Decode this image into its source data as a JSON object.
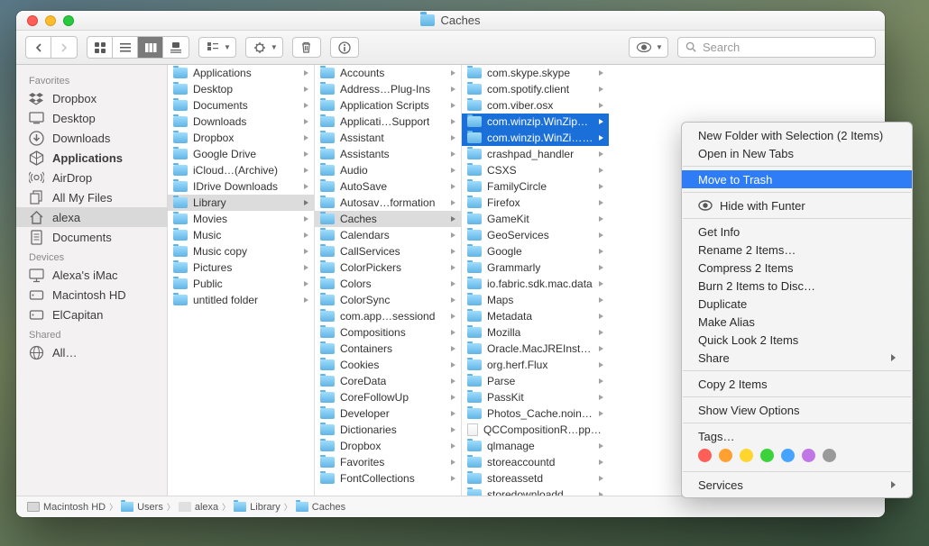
{
  "title": "Caches",
  "search_placeholder": "Search",
  "sidebar": {
    "sections": [
      {
        "header": "Favorites",
        "items": [
          {
            "icon": "dropbox",
            "label": "Dropbox"
          },
          {
            "icon": "desktop",
            "label": "Desktop"
          },
          {
            "icon": "downloads",
            "label": "Downloads"
          },
          {
            "icon": "apps",
            "label": "Applications",
            "bold": true
          },
          {
            "icon": "airdrop",
            "label": "AirDrop"
          },
          {
            "icon": "allfiles",
            "label": "All My Files"
          },
          {
            "icon": "home",
            "label": "alexa",
            "sel": true
          },
          {
            "icon": "docs",
            "label": "Documents"
          }
        ]
      },
      {
        "header": "Devices",
        "items": [
          {
            "icon": "imac",
            "label": "Alexa's iMac"
          },
          {
            "icon": "hd",
            "label": "Macintosh HD"
          },
          {
            "icon": "hd",
            "label": "ElCapitan"
          }
        ]
      },
      {
        "header": "Shared",
        "items": [
          {
            "icon": "globe",
            "label": "All…"
          }
        ]
      }
    ]
  },
  "columns": [
    [
      {
        "n": "Applications",
        "t": "folder"
      },
      {
        "n": "Desktop",
        "t": "folder"
      },
      {
        "n": "Documents",
        "t": "folder"
      },
      {
        "n": "Downloads",
        "t": "folder"
      },
      {
        "n": "Dropbox",
        "t": "folder"
      },
      {
        "n": "Google Drive",
        "t": "folder"
      },
      {
        "n": "iCloud…(Archive)",
        "t": "folder"
      },
      {
        "n": "IDrive Downloads",
        "t": "folder"
      },
      {
        "n": "Library",
        "t": "folder",
        "sel": true
      },
      {
        "n": "Movies",
        "t": "folder"
      },
      {
        "n": "Music",
        "t": "folder"
      },
      {
        "n": "Music copy",
        "t": "folder"
      },
      {
        "n": "Pictures",
        "t": "folder"
      },
      {
        "n": "Public",
        "t": "folder"
      },
      {
        "n": "untitled folder",
        "t": "folder"
      }
    ],
    [
      {
        "n": "Accounts",
        "t": "folder"
      },
      {
        "n": "Address…Plug-Ins",
        "t": "folder"
      },
      {
        "n": "Application Scripts",
        "t": "folder"
      },
      {
        "n": "Applicati…Support",
        "t": "folder"
      },
      {
        "n": "Assistant",
        "t": "folder"
      },
      {
        "n": "Assistants",
        "t": "folder"
      },
      {
        "n": "Audio",
        "t": "folder"
      },
      {
        "n": "AutoSave",
        "t": "folder"
      },
      {
        "n": "Autosav…formation",
        "t": "folder"
      },
      {
        "n": "Caches",
        "t": "folder",
        "sel": true
      },
      {
        "n": "Calendars",
        "t": "folder"
      },
      {
        "n": "CallServices",
        "t": "folder"
      },
      {
        "n": "ColorPickers",
        "t": "folder"
      },
      {
        "n": "Colors",
        "t": "folder"
      },
      {
        "n": "ColorSync",
        "t": "folder"
      },
      {
        "n": "com.app…sessiond",
        "t": "folder"
      },
      {
        "n": "Compositions",
        "t": "folder"
      },
      {
        "n": "Containers",
        "t": "folder"
      },
      {
        "n": "Cookies",
        "t": "folder"
      },
      {
        "n": "CoreData",
        "t": "folder"
      },
      {
        "n": "CoreFollowUp",
        "t": "folder"
      },
      {
        "n": "Developer",
        "t": "folder"
      },
      {
        "n": "Dictionaries",
        "t": "folder"
      },
      {
        "n": "Dropbox",
        "t": "folder"
      },
      {
        "n": "Favorites",
        "t": "folder"
      },
      {
        "n": "FontCollections",
        "t": "folder"
      }
    ],
    [
      {
        "n": "com.skype.skype",
        "t": "folder"
      },
      {
        "n": "com.spotify.client",
        "t": "folder"
      },
      {
        "n": "com.viber.osx",
        "t": "folder"
      },
      {
        "n": "com.winzip.WinZipMacOptimizer",
        "t": "folder",
        "hl": true
      },
      {
        "n": "com.winzip.WinZi…imizer.LoginHel",
        "t": "folder",
        "hl": true
      },
      {
        "n": "crashpad_handler",
        "t": "folder"
      },
      {
        "n": "CSXS",
        "t": "folder"
      },
      {
        "n": "FamilyCircle",
        "t": "folder"
      },
      {
        "n": "Firefox",
        "t": "folder"
      },
      {
        "n": "GameKit",
        "t": "folder"
      },
      {
        "n": "GeoServices",
        "t": "folder"
      },
      {
        "n": "Google",
        "t": "folder"
      },
      {
        "n": "Grammarly",
        "t": "folder"
      },
      {
        "n": "io.fabric.sdk.mac.data",
        "t": "folder"
      },
      {
        "n": "Maps",
        "t": "folder"
      },
      {
        "n": "Metadata",
        "t": "folder"
      },
      {
        "n": "Mozilla",
        "t": "folder"
      },
      {
        "n": "Oracle.MacJREInstaller",
        "t": "folder"
      },
      {
        "n": "org.herf.Flux",
        "t": "folder"
      },
      {
        "n": "Parse",
        "t": "folder"
      },
      {
        "n": "PassKit",
        "t": "folder"
      },
      {
        "n": "Photos_Cache.noindex",
        "t": "folder"
      },
      {
        "n": "QCCompositionR…pple.iTunes.cac",
        "t": "doc"
      },
      {
        "n": "qlmanage",
        "t": "folder"
      },
      {
        "n": "storeaccountd",
        "t": "folder"
      },
      {
        "n": "storeassetd",
        "t": "folder"
      },
      {
        "n": "storedownloadd",
        "t": "folder"
      }
    ]
  ],
  "pathbar": [
    {
      "icon": "hd",
      "label": "Macintosh HD"
    },
    {
      "icon": "folder",
      "label": "Users"
    },
    {
      "icon": "home",
      "label": "alexa"
    },
    {
      "icon": "folder",
      "label": "Library"
    },
    {
      "icon": "folder",
      "label": "Caches"
    }
  ],
  "context": {
    "groups": [
      [
        {
          "label": "New Folder with Selection (2 Items)"
        },
        {
          "label": "Open in New Tabs"
        }
      ],
      [
        {
          "label": "Move to Trash",
          "hl": true
        }
      ],
      [
        {
          "label": "Hide with Funter",
          "icon": "funter"
        }
      ],
      [
        {
          "label": "Get Info"
        },
        {
          "label": "Rename 2 Items…"
        },
        {
          "label": "Compress 2 Items"
        },
        {
          "label": "Burn 2 Items to Disc…"
        },
        {
          "label": "Duplicate"
        },
        {
          "label": "Make Alias"
        },
        {
          "label": "Quick Look 2 Items"
        },
        {
          "label": "Share",
          "sub": true
        }
      ],
      [
        {
          "label": "Copy 2 Items"
        }
      ],
      [
        {
          "label": "Show View Options"
        }
      ],
      [
        {
          "label": "Tags…",
          "tags": true
        }
      ],
      [
        {
          "label": "Services",
          "sub": true
        }
      ]
    ],
    "tag_colors": [
      "#ff5f56",
      "#ffa030",
      "#ffd52e",
      "#3cd23c",
      "#44a4ff",
      "#c176e8",
      "#9a9a9a"
    ]
  }
}
